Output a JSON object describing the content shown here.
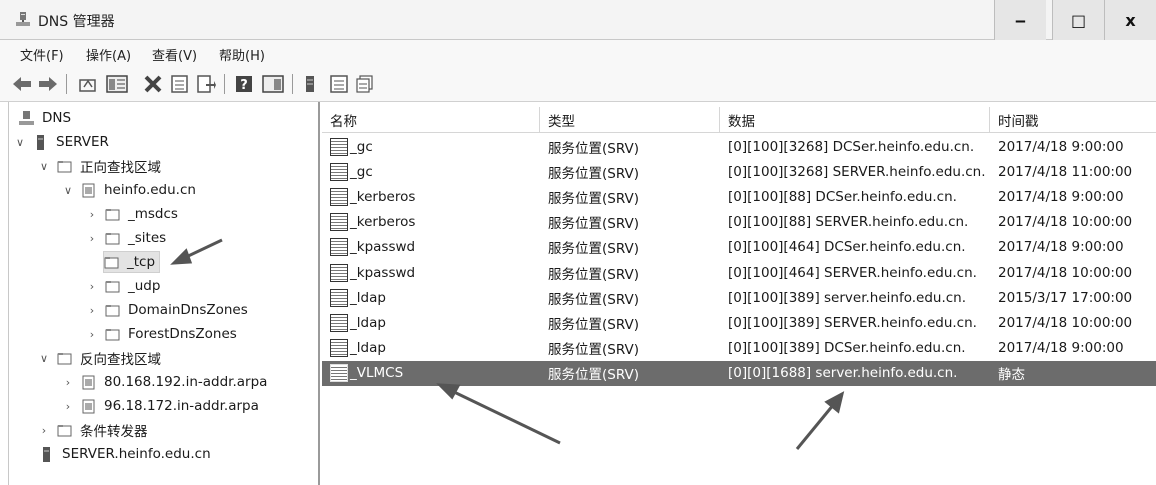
{
  "window": {
    "title": "DNS 管理器",
    "minimize": "‒",
    "maximize": "□",
    "close": "x"
  },
  "menu": [
    "文件(F)",
    "操作(A)",
    "查看(V)",
    "帮助(H)"
  ],
  "toolbar": {
    "icons": [
      "back-icon",
      "forward-icon",
      "up-folder-icon",
      "show-hide-tree-icon",
      "delete-icon",
      "properties-icon",
      "export-icon",
      "help-icon",
      "console-icon",
      "server-icon",
      "list-icon",
      "new-record-icon"
    ]
  },
  "tree": {
    "root": "DNS",
    "server": "SERVER",
    "forward_zones": "正向查找区域",
    "zone": "heinfo.edu.cn",
    "msdcs": "_msdcs",
    "sites": "_sites",
    "tcp": "_tcp",
    "udp": "_udp",
    "domain_dns_zones": "DomainDnsZones",
    "forest_dns_zones": "ForestDnsZones",
    "reverse_zones": "反向查找区域",
    "rev1": "80.168.192.in-addr.arpa",
    "rev2": "96.18.172.in-addr.arpa",
    "forwarders": "条件转发器",
    "server_fqdn": "SERVER.heinfo.edu.cn"
  },
  "list": {
    "columns": [
      "名称",
      "类型",
      "数据",
      "时间戳"
    ],
    "rows": [
      [
        "_gc",
        "服务位置(SRV)",
        "[0][100][3268] DCSer.heinfo.edu.cn.",
        "2017/4/18 9:00:00"
      ],
      [
        "_gc",
        "服务位置(SRV)",
        "[0][100][3268] SERVER.heinfo.edu.cn.",
        "2017/4/18 11:00:00"
      ],
      [
        "_kerberos",
        "服务位置(SRV)",
        "[0][100][88] DCSer.heinfo.edu.cn.",
        "2017/4/18 9:00:00"
      ],
      [
        "_kerberos",
        "服务位置(SRV)",
        "[0][100][88] SERVER.heinfo.edu.cn.",
        "2017/4/18 10:00:00"
      ],
      [
        "_kpasswd",
        "服务位置(SRV)",
        "[0][100][464] DCSer.heinfo.edu.cn.",
        "2017/4/18 9:00:00"
      ],
      [
        "_kpasswd",
        "服务位置(SRV)",
        "[0][100][464] SERVER.heinfo.edu.cn.",
        "2017/4/18 10:00:00"
      ],
      [
        "_ldap",
        "服务位置(SRV)",
        "[0][100][389] server.heinfo.edu.cn.",
        "2015/3/17 17:00:00"
      ],
      [
        "_ldap",
        "服务位置(SRV)",
        "[0][100][389] SERVER.heinfo.edu.cn.",
        "2017/4/18 10:00:00"
      ],
      [
        "_ldap",
        "服务位置(SRV)",
        "[0][100][389] DCSer.heinfo.edu.cn.",
        "2017/4/18 9:00:00"
      ],
      [
        "_VLMCS",
        "服务位置(SRV)",
        "[0][0][1688] server.heinfo.edu.cn.",
        "静态"
      ]
    ],
    "selected_row": 9
  }
}
